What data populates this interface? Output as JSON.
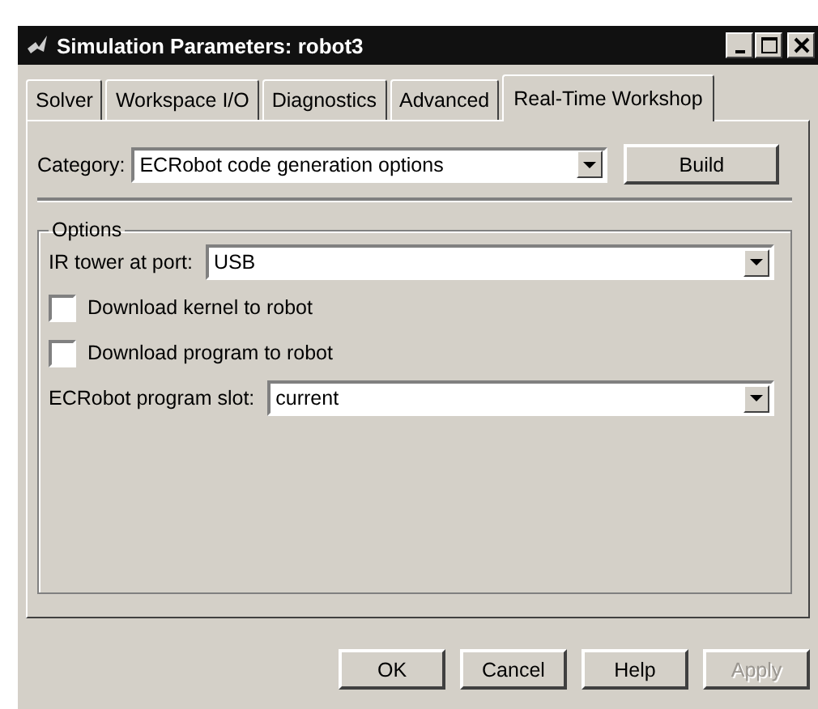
{
  "window": {
    "title": "Simulation Parameters: robot3"
  },
  "tabs": [
    {
      "label": "Solver",
      "selected": false
    },
    {
      "label": "Workspace I/O",
      "selected": false
    },
    {
      "label": "Diagnostics",
      "selected": false
    },
    {
      "label": "Advanced",
      "selected": false
    },
    {
      "label": "Real-Time Workshop",
      "selected": true
    }
  ],
  "category": {
    "label": "Category:",
    "value": "ECRobot code generation options"
  },
  "build_button": "Build",
  "options": {
    "title": "Options",
    "ir_tower": {
      "label": "IR tower at port:",
      "value": "USB"
    },
    "checkboxes": [
      {
        "label": "Download kernel to robot",
        "checked": false
      },
      {
        "label": "Download program to robot",
        "checked": false
      }
    ],
    "program_slot": {
      "label": "ECRobot program slot:",
      "value": "current"
    }
  },
  "buttons": [
    {
      "label": "OK",
      "disabled": false
    },
    {
      "label": "Cancel",
      "disabled": false
    },
    {
      "label": "Help",
      "disabled": false
    },
    {
      "label": "Apply",
      "disabled": true
    }
  ]
}
